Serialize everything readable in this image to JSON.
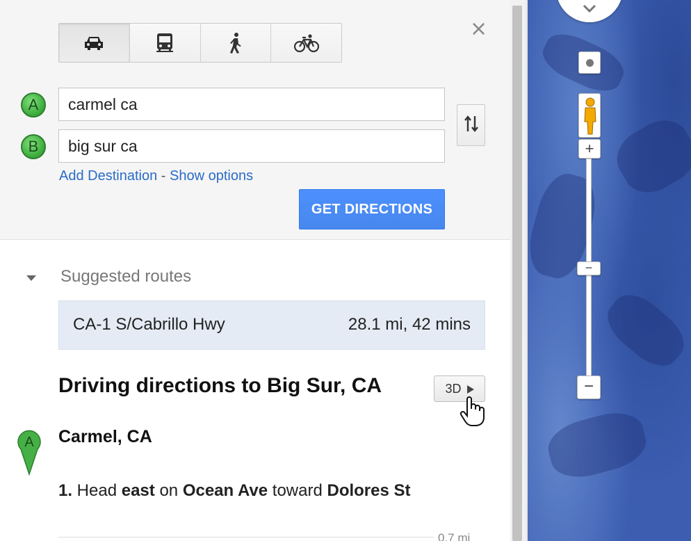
{
  "travel_modes": [
    {
      "name": "car",
      "icon": "car-icon",
      "active": true
    },
    {
      "name": "transit",
      "icon": "bus-icon",
      "active": false
    },
    {
      "name": "walking",
      "icon": "walking-icon",
      "active": false
    },
    {
      "name": "bicycling",
      "icon": "bicycle-icon",
      "active": false
    }
  ],
  "close_glyph": "×",
  "origin": {
    "marker": "A",
    "value": "carmel ca"
  },
  "destination": {
    "marker": "B",
    "value": "big sur ca"
  },
  "links": {
    "add_destination": "Add Destination",
    "separator": " - ",
    "show_options": "Show options"
  },
  "get_directions_label": "GET DIRECTIONS",
  "suggested_routes_label": "Suggested routes",
  "route": {
    "name": "CA-1 S/Cabrillo Hwy",
    "summary": "28.1 mi, 42 mins"
  },
  "directions_heading": "Driving directions to Big Sur, CA",
  "btn_3d_label": "3D",
  "start_marker": "A",
  "start_place": "Carmel, CA",
  "step1": {
    "number": "1.",
    "text_pre": " Head ",
    "direction": "east",
    "text_mid": " on ",
    "road": "Ocean Ave",
    "text_toward": " toward ",
    "toward": "Dolores St",
    "distance": "0.7 mi"
  },
  "map_controls": {
    "zoom_in": "+",
    "zoom_out": "−",
    "zoom_level_marker": "−"
  },
  "colors": {
    "accent_blue": "#4d90fe",
    "link": "#2a6bc7",
    "marker_green": "#3aa83a",
    "route_card": "#e4ebf5",
    "map_water": "#3c5db0"
  }
}
